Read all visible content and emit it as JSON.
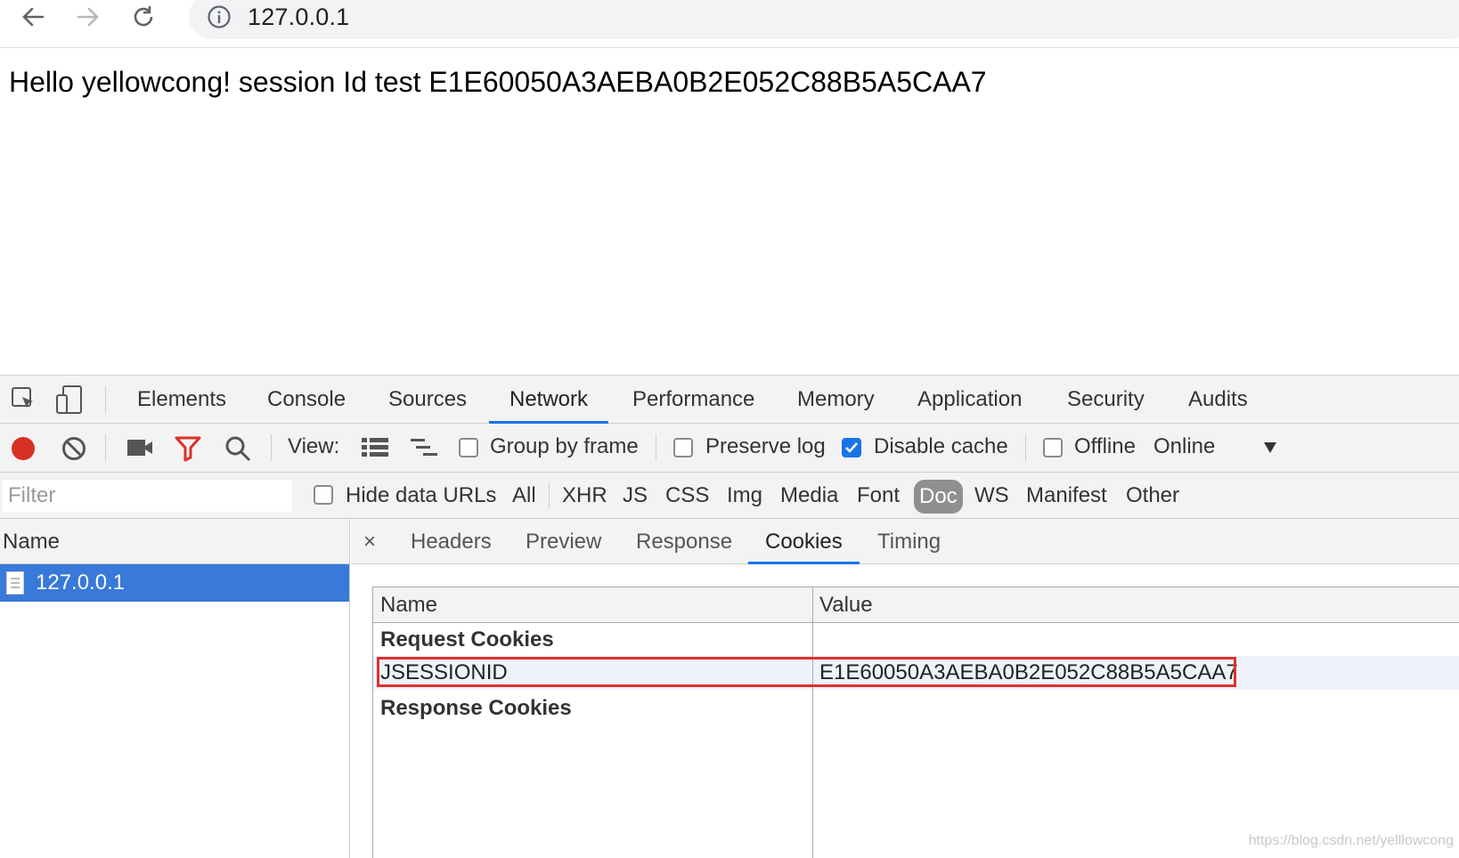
{
  "browser": {
    "url": "127.0.0.1"
  },
  "page": {
    "text": "Hello yellowcong! session Id test E1E60050A3AEBA0B2E052C88B5A5CAA7"
  },
  "devtools": {
    "tabs": [
      {
        "label": "Elements"
      },
      {
        "label": "Console"
      },
      {
        "label": "Sources"
      },
      {
        "label": "Network",
        "active": true
      },
      {
        "label": "Performance"
      },
      {
        "label": "Memory"
      },
      {
        "label": "Application"
      },
      {
        "label": "Security"
      },
      {
        "label": "Audits"
      }
    ],
    "toolbar": {
      "view_label": "View:",
      "group_by_frame": "Group by frame",
      "preserve_log": "Preserve log",
      "disable_cache": "Disable cache",
      "disable_cache_checked": true,
      "offline": "Offline",
      "throttle": "Online"
    },
    "filter": {
      "placeholder": "Filter",
      "hide_data_urls": "Hide data URLs",
      "types": [
        "All",
        "XHR",
        "JS",
        "CSS",
        "Img",
        "Media",
        "Font",
        "Doc",
        "WS",
        "Manifest",
        "Other"
      ],
      "active_type": "Doc"
    },
    "request_list": {
      "header": "Name",
      "rows": [
        "127.0.0.1"
      ]
    },
    "detail": {
      "close": "×",
      "tabs": [
        "Headers",
        "Preview",
        "Response",
        "Cookies",
        "Timing"
      ],
      "active_tab": "Cookies",
      "table": {
        "columns": [
          "Name",
          "Value"
        ],
        "request_cookies_label": "Request Cookies",
        "response_cookies_label": "Response Cookies",
        "cookies": [
          {
            "name": "JSESSIONID",
            "value": "E1E60050A3AEBA0B2E052C88B5A5CAA7"
          }
        ]
      }
    }
  },
  "watermark": "https://blog.csdn.net/yelllowcong",
  "colors": {
    "accent": "#1a73e8",
    "selection": "#3879d9",
    "record": "#d93025",
    "highlight": "#e0302a"
  }
}
